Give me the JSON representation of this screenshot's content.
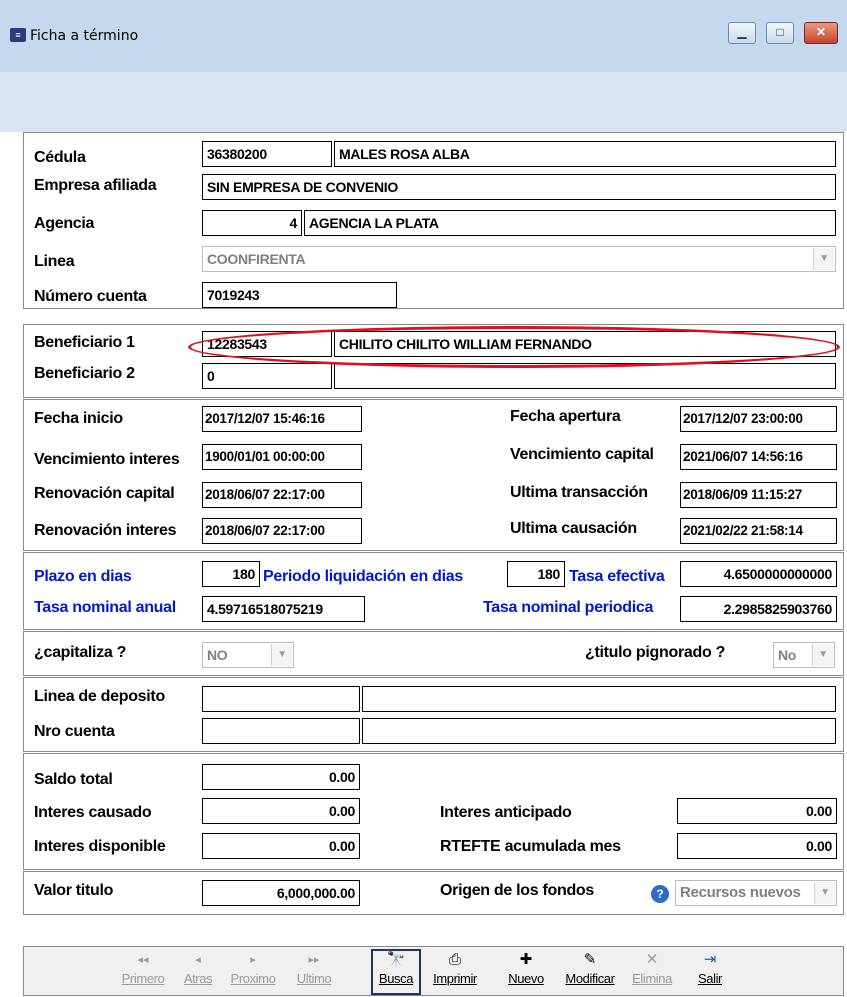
{
  "window": {
    "title": "Ficha a término"
  },
  "header": {
    "cedula_label": "Cédula",
    "cedula_value": "36380200",
    "nombre_value": "MALES ROSA ALBA",
    "empresa_label": "Empresa afiliada",
    "empresa_value": "SIN EMPRESA DE CONVENIO",
    "agencia_label": "Agencia",
    "agencia_code": "4",
    "agencia_name": "AGENCIA LA PLATA",
    "linea_label": "Linea",
    "linea_value": "COONFIRENTA",
    "cuenta_label": "Número cuenta",
    "cuenta_value": "7019243"
  },
  "beneficiarios": {
    "b1_label": "Beneficiario 1",
    "b1_id": "12283543",
    "b1_name": "CHILITO CHILITO WILLIAM FERNANDO",
    "b2_label": "Beneficiario 2",
    "b2_id": "0",
    "b2_name": ""
  },
  "fechas": {
    "inicio_label": "Fecha inicio",
    "inicio_value": "2017/12/07 15:46:16",
    "venc_int_label": "Vencimiento interes",
    "venc_int_value": "1900/01/01 00:00:00",
    "renov_cap_label": "Renovación capital",
    "renov_cap_value": "2018/06/07 22:17:00",
    "renov_int_label": "Renovación interes",
    "renov_int_value": "2018/06/07 22:17:00",
    "apertura_label": "Fecha apertura",
    "apertura_value": "2017/12/07 23:00:00",
    "venc_cap_label": "Vencimiento capital",
    "venc_cap_value": "2021/06/07 14:56:16",
    "ult_trans_label": "Ultima transacción",
    "ult_trans_value": "2018/06/09 11:15:27",
    "ult_caus_label": "Ultima causación",
    "ult_caus_value": "2021/02/22 21:58:14"
  },
  "tasas": {
    "plazo_label": "Plazo en  dias",
    "plazo_value": "180",
    "periodo_label": "Periodo liquidación en dias",
    "periodo_value": "180",
    "efectiva_label": "Tasa efectiva",
    "efectiva_value": "4.6500000000000",
    "nominal_anual_label": "Tasa nominal anual",
    "nominal_anual_value": "4.59716518075219",
    "nominal_periodica_label": "Tasa nominal periodica",
    "nominal_periodica_value": "2.2985825903760"
  },
  "opciones": {
    "capitaliza_label": "¿capitaliza ?",
    "capitaliza_value": "NO",
    "pignorado_label": "¿titulo pignorado ?",
    "pignorado_value": "No"
  },
  "deposito": {
    "linea_label": "Linea de deposito",
    "nro_label": "Nro cuenta"
  },
  "saldos": {
    "saldo_total_label": "Saldo total",
    "saldo_total_value": "0.00",
    "int_causado_label": "Interes causado",
    "int_causado_value": "0.00",
    "int_disponible_label": "Interes disponible",
    "int_disponible_value": "0.00",
    "int_anticipado_label": "Interes anticipado",
    "int_anticipado_value": "0.00",
    "rtefte_label": "RTEFTE acumulada mes",
    "rtefte_value": "0.00"
  },
  "valor": {
    "valor_label": "Valor titulo",
    "valor_value": "6,000,000.00",
    "origen_label": "Origen de los fondos",
    "origen_value": "Recursos nuevos"
  },
  "toolbar": {
    "primero": "Primero",
    "atras": "Atras",
    "proximo": "Proximo",
    "ultimo": "Ultimo",
    "busca": "Busca",
    "imprimir": "Imprimir",
    "nuevo": "Nuevo",
    "modificar": "Modificar",
    "elimina": "Elimina",
    "salir": "Salir"
  }
}
